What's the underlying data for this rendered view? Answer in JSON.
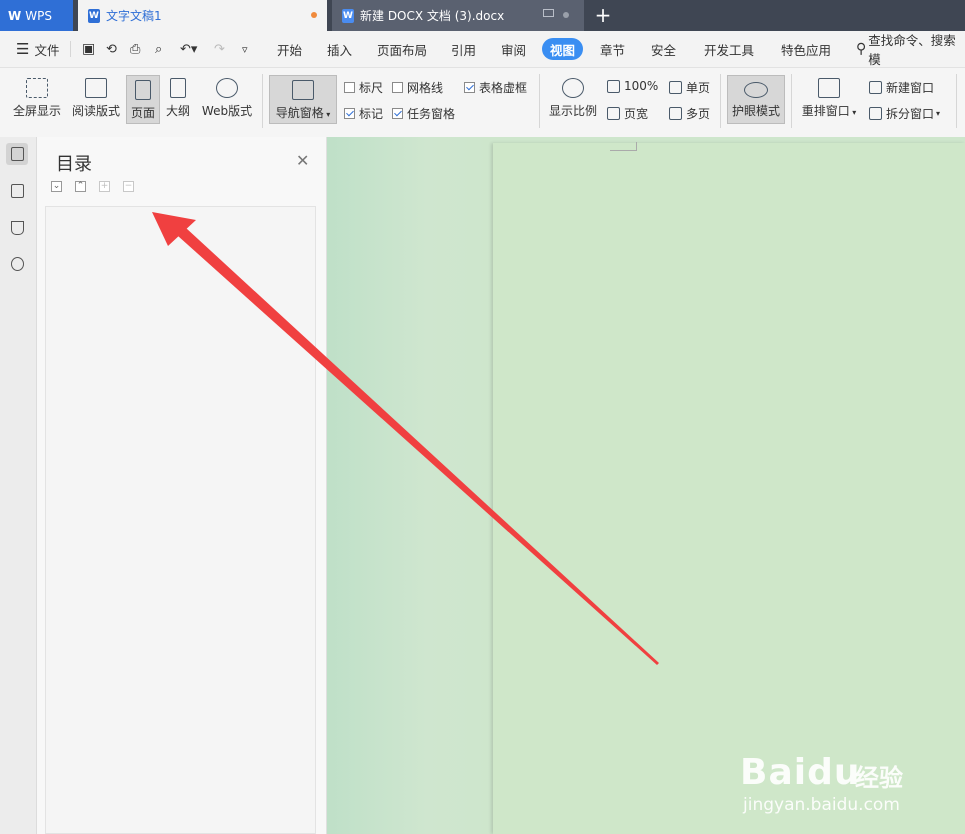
{
  "titlebar": {
    "app_label": "WPS",
    "tabs": [
      {
        "label": "文字文稿1"
      },
      {
        "label": "新建 DOCX 文档 (3).docx"
      }
    ],
    "new_tab": "+"
  },
  "menubar": {
    "file_label": "文件",
    "items": [
      "开始",
      "插入",
      "页面布局",
      "引用",
      "审阅",
      "视图",
      "章节",
      "安全",
      "开发工具",
      "特色应用"
    ],
    "active_item": "视图",
    "search_placeholder": "查找命令、搜索模"
  },
  "ribbon": {
    "view_modes": [
      "全屏显示",
      "阅读版式",
      "页面",
      "大纲",
      "Web版式"
    ],
    "selected_mode": "页面",
    "nav_pane_label": "导航窗格",
    "checkboxes": [
      {
        "label": "标尺",
        "checked": false
      },
      {
        "label": "网格线",
        "checked": false
      },
      {
        "label": "表格虚框",
        "checked": true
      },
      {
        "label": "标记",
        "checked": true
      },
      {
        "label": "任务窗格",
        "checked": true
      }
    ],
    "zoom_label": "显示比例",
    "zoom_100": "100%",
    "page_width": "页宽",
    "single_page": "单页",
    "multi_page": "多页",
    "eye_mode": "护眼模式",
    "rearrange": "重排窗口",
    "new_window": "新建窗口",
    "split_window": "拆分窗口"
  },
  "nav_panel": {
    "title": "目录"
  },
  "watermark": {
    "brand": "Baidu",
    "brand_cn": "经验",
    "url": "jingyan.baidu.com"
  },
  "colors": {
    "accent": "#3a8ef2",
    "eye_background": "#cfe7c9",
    "arrow": "#f04040"
  }
}
